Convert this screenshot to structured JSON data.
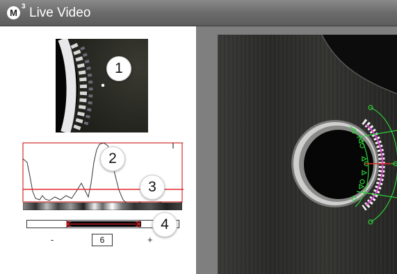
{
  "window": {
    "title": "Live Video",
    "logo_letter": "M",
    "logo_superscript": "3"
  },
  "zoom_view": {
    "callout": "1"
  },
  "profile_graph": {
    "callout_profile": "2",
    "callout_threshold": "3",
    "threshold_color": "#e0262a",
    "callout_range": "4"
  },
  "edge_width": {
    "decrement_label": "-",
    "value": "6",
    "increment_label": "+"
  },
  "overlay": {
    "tool_color": "#2fcf3a",
    "edge_color": "#d43cc8"
  }
}
